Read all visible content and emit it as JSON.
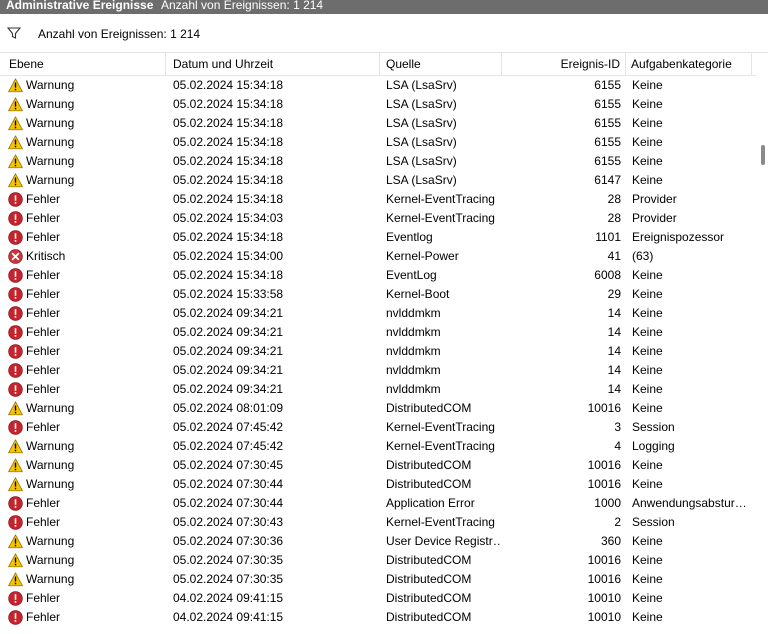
{
  "title": {
    "panel": "Administrative Ereignisse",
    "count": "Anzahl von Ereignissen: 1 214"
  },
  "filter": {
    "text": "Anzahl von Ereignissen: 1 214",
    "icon": "filter-icon"
  },
  "columns": {
    "level": "Ebene",
    "date": "Datum und Uhrzeit",
    "source": "Quelle",
    "id": "Ereignis-ID",
    "category": "Aufgabenkategorie"
  },
  "icons": {
    "warning": "warning-icon",
    "error": "error-icon",
    "critical": "critical-icon"
  },
  "colors": {
    "warning": "#f5c400",
    "error": "#c8232c",
    "critical": "#d0323b",
    "titlebar": "#6d6d6d"
  },
  "rows": [
    {
      "type": "warning",
      "level": "Warnung",
      "date": "05.02.2024 15:34:18",
      "source": "LSA (LsaSrv)",
      "id": "6155",
      "category": "Keine"
    },
    {
      "type": "warning",
      "level": "Warnung",
      "date": "05.02.2024 15:34:18",
      "source": "LSA (LsaSrv)",
      "id": "6155",
      "category": "Keine"
    },
    {
      "type": "warning",
      "level": "Warnung",
      "date": "05.02.2024 15:34:18",
      "source": "LSA (LsaSrv)",
      "id": "6155",
      "category": "Keine"
    },
    {
      "type": "warning",
      "level": "Warnung",
      "date": "05.02.2024 15:34:18",
      "source": "LSA (LsaSrv)",
      "id": "6155",
      "category": "Keine"
    },
    {
      "type": "warning",
      "level": "Warnung",
      "date": "05.02.2024 15:34:18",
      "source": "LSA (LsaSrv)",
      "id": "6155",
      "category": "Keine"
    },
    {
      "type": "warning",
      "level": "Warnung",
      "date": "05.02.2024 15:34:18",
      "source": "LSA (LsaSrv)",
      "id": "6147",
      "category": "Keine"
    },
    {
      "type": "error",
      "level": "Fehler",
      "date": "05.02.2024 15:34:18",
      "source": "Kernel-EventTracing",
      "id": "28",
      "category": "Provider"
    },
    {
      "type": "error",
      "level": "Fehler",
      "date": "05.02.2024 15:34:03",
      "source": "Kernel-EventTracing",
      "id": "28",
      "category": "Provider"
    },
    {
      "type": "error",
      "level": "Fehler",
      "date": "05.02.2024 15:34:18",
      "source": "Eventlog",
      "id": "1101",
      "category": "Ereignispozessor"
    },
    {
      "type": "critical",
      "level": "Kritisch",
      "date": "05.02.2024 15:34:00",
      "source": "Kernel-Power",
      "id": "41",
      "category": "(63)"
    },
    {
      "type": "error",
      "level": "Fehler",
      "date": "05.02.2024 15:34:18",
      "source": "EventLog",
      "id": "6008",
      "category": "Keine"
    },
    {
      "type": "error",
      "level": "Fehler",
      "date": "05.02.2024 15:33:58",
      "source": "Kernel-Boot",
      "id": "29",
      "category": "Keine"
    },
    {
      "type": "error",
      "level": "Fehler",
      "date": "05.02.2024 09:34:21",
      "source": "nvlddmkm",
      "id": "14",
      "category": "Keine"
    },
    {
      "type": "error",
      "level": "Fehler",
      "date": "05.02.2024 09:34:21",
      "source": "nvlddmkm",
      "id": "14",
      "category": "Keine"
    },
    {
      "type": "error",
      "level": "Fehler",
      "date": "05.02.2024 09:34:21",
      "source": "nvlddmkm",
      "id": "14",
      "category": "Keine"
    },
    {
      "type": "error",
      "level": "Fehler",
      "date": "05.02.2024 09:34:21",
      "source": "nvlddmkm",
      "id": "14",
      "category": "Keine"
    },
    {
      "type": "error",
      "level": "Fehler",
      "date": "05.02.2024 09:34:21",
      "source": "nvlddmkm",
      "id": "14",
      "category": "Keine"
    },
    {
      "type": "warning",
      "level": "Warnung",
      "date": "05.02.2024 08:01:09",
      "source": "DistributedCOM",
      "id": "10016",
      "category": "Keine"
    },
    {
      "type": "error",
      "level": "Fehler",
      "date": "05.02.2024 07:45:42",
      "source": "Kernel-EventTracing",
      "id": "3",
      "category": "Session"
    },
    {
      "type": "warning",
      "level": "Warnung",
      "date": "05.02.2024 07:45:42",
      "source": "Kernel-EventTracing",
      "id": "4",
      "category": "Logging"
    },
    {
      "type": "warning",
      "level": "Warnung",
      "date": "05.02.2024 07:30:45",
      "source": "DistributedCOM",
      "id": "10016",
      "category": "Keine"
    },
    {
      "type": "warning",
      "level": "Warnung",
      "date": "05.02.2024 07:30:44",
      "source": "DistributedCOM",
      "id": "10016",
      "category": "Keine"
    },
    {
      "type": "error",
      "level": "Fehler",
      "date": "05.02.2024 07:30:44",
      "source": "Application Error",
      "id": "1000",
      "category": "Anwendungsabstur…"
    },
    {
      "type": "error",
      "level": "Fehler",
      "date": "05.02.2024 07:30:43",
      "source": "Kernel-EventTracing",
      "id": "2",
      "category": "Session"
    },
    {
      "type": "warning",
      "level": "Warnung",
      "date": "05.02.2024 07:30:36",
      "source": "User Device Registr…",
      "id": "360",
      "category": "Keine"
    },
    {
      "type": "warning",
      "level": "Warnung",
      "date": "05.02.2024 07:30:35",
      "source": "DistributedCOM",
      "id": "10016",
      "category": "Keine"
    },
    {
      "type": "warning",
      "level": "Warnung",
      "date": "05.02.2024 07:30:35",
      "source": "DistributedCOM",
      "id": "10016",
      "category": "Keine"
    },
    {
      "type": "error",
      "level": "Fehler",
      "date": "04.02.2024 09:41:15",
      "source": "DistributedCOM",
      "id": "10010",
      "category": "Keine"
    },
    {
      "type": "error",
      "level": "Fehler",
      "date": "04.02.2024 09:41:15",
      "source": "DistributedCOM",
      "id": "10010",
      "category": "Keine"
    }
  ]
}
